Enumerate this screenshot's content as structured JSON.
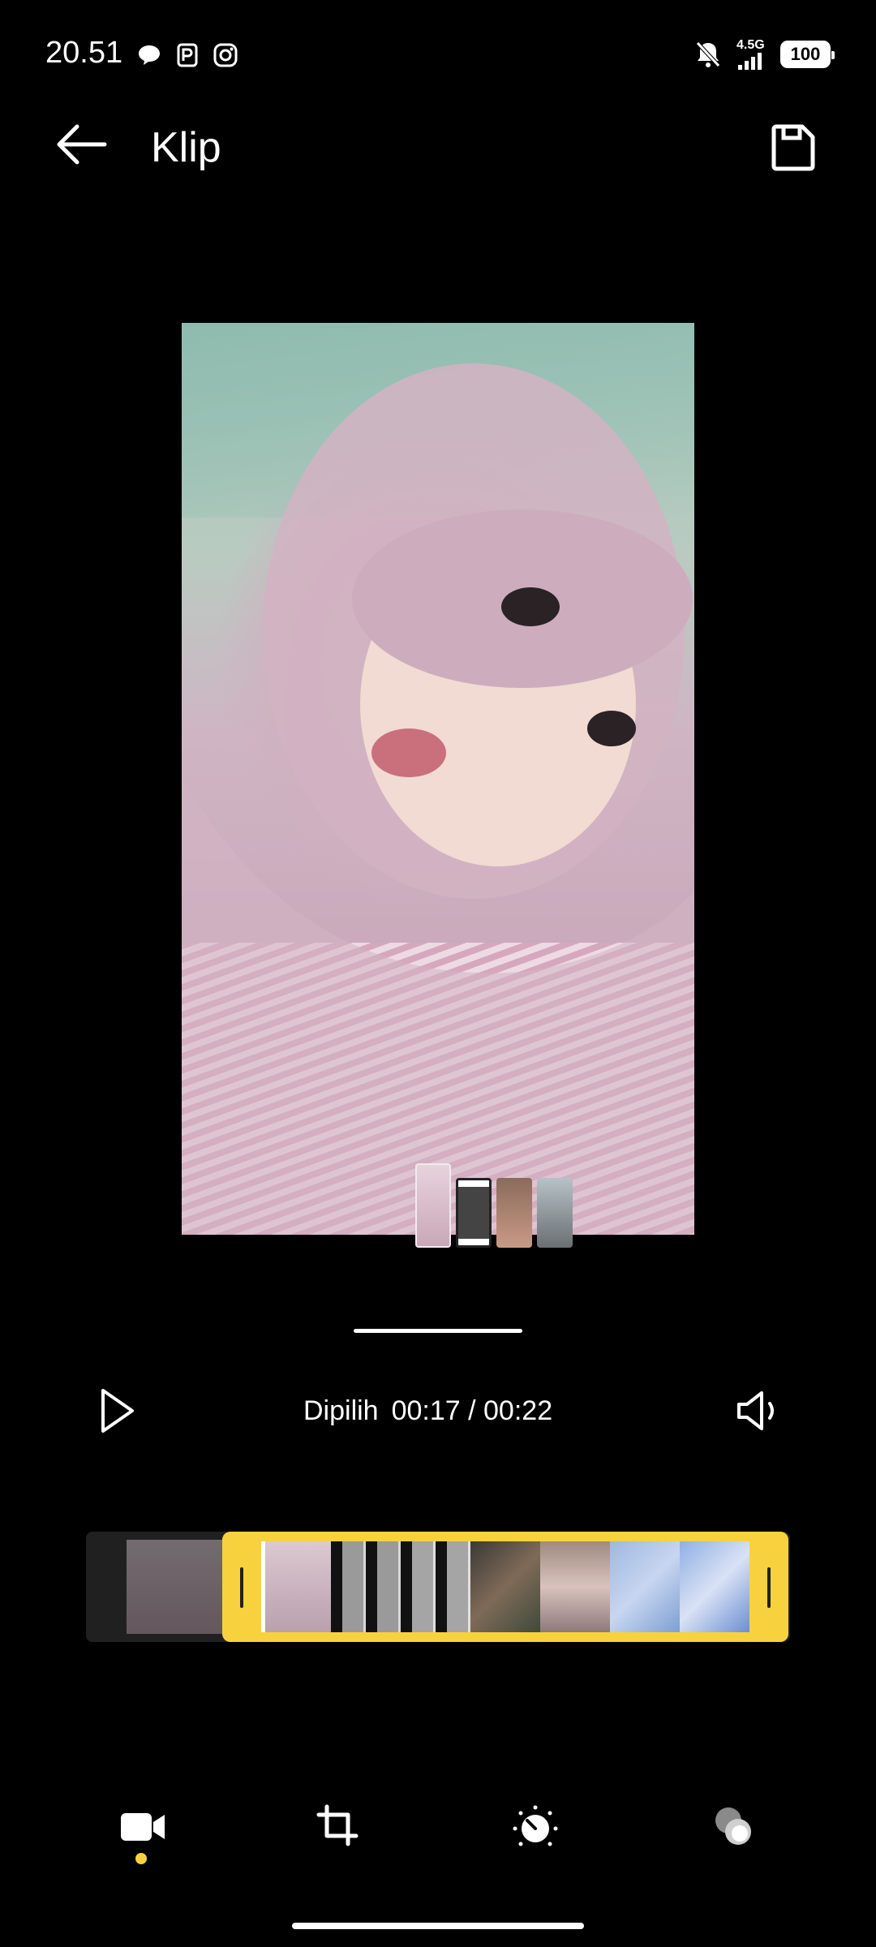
{
  "status_bar": {
    "time": "20.51",
    "network": "4.5G",
    "battery": "100",
    "left_icons": [
      "chat-bubble-icon",
      "parking-app-icon",
      "instagram-icon"
    ],
    "right_icons": [
      "bell-off-icon",
      "signal-icon",
      "battery-icon"
    ]
  },
  "header": {
    "title": "Klip",
    "back_icon": "arrow-left-icon",
    "save_icon": "save-icon"
  },
  "playback": {
    "label": "Dipilih",
    "time": "00:17 / 00:22",
    "play_icon": "play-icon",
    "volume_icon": "volume-icon"
  },
  "toolbar": {
    "items": [
      "video-camera-icon",
      "crop-icon",
      "adjust-dial-icon",
      "filter-circles-icon"
    ],
    "active_index": 0
  },
  "colors": {
    "accent": "#f7d23e",
    "background": "#000000",
    "timeline_bg": "#202020"
  }
}
